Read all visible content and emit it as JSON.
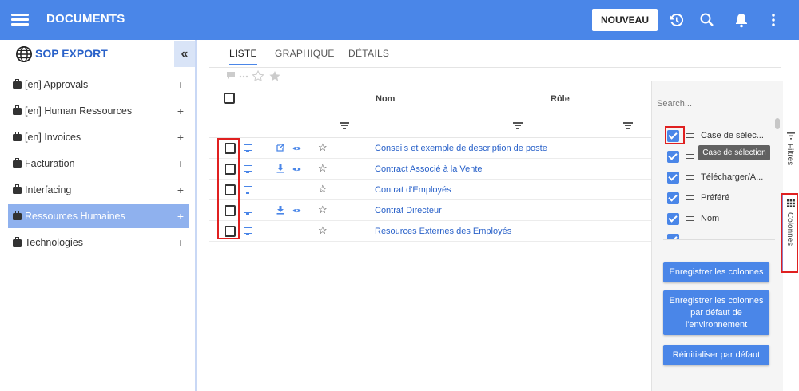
{
  "topbar": {
    "title": "DOCUMENTS",
    "new_button": "NOUVEAU",
    "icons": [
      "menu-icon",
      "history-icon",
      "search-icon",
      "bell-icon",
      "more-vert-icon"
    ],
    "color": "#4a86e8"
  },
  "sidebar": {
    "title": "SOP EXPORT",
    "collapse_glyph": "«",
    "items": [
      {
        "label": "[en] Approvals",
        "plus": "+"
      },
      {
        "label": "[en] Human Ressources",
        "plus": "+"
      },
      {
        "label": "[en] Invoices",
        "plus": "+"
      },
      {
        "label": "Facturation",
        "plus": "+"
      },
      {
        "label": "Interfacing",
        "plus": "+"
      },
      {
        "label": "Ressources Humaines",
        "plus": "+",
        "active": true
      },
      {
        "label": "Technologies",
        "plus": "+"
      }
    ]
  },
  "tabs": [
    {
      "label": "LISTE",
      "active": true
    },
    {
      "label": "GRAPHIQUE"
    },
    {
      "label": "DÉTAILS"
    }
  ],
  "grid": {
    "columns": {
      "name": "Nom",
      "role": "Rôle"
    },
    "rows": [
      {
        "name": "Conseils et exemple de description de poste",
        "action": "open-external"
      },
      {
        "name": "Contract Associé à la Vente",
        "action": "download"
      },
      {
        "name": "Contrat d'Employés",
        "action": "none"
      },
      {
        "name": "Contrat Directeur",
        "action": "download"
      },
      {
        "name": "Resources Externes des Employés",
        "action": "none"
      }
    ]
  },
  "column_panel": {
    "search_placeholder": "Search...",
    "columns": [
      {
        "label": "Case de sélec...",
        "checked": true
      },
      {
        "label": "",
        "checked": true
      },
      {
        "label": "Télécharger/A...",
        "checked": true
      },
      {
        "label": "Préféré",
        "checked": true
      },
      {
        "label": "Nom",
        "checked": true
      }
    ],
    "tooltip": "Case de sélection",
    "save_button": "Enregistrer les colonnes",
    "save_default_button": "Enregistrer les colonnes par défaut de l'environnement",
    "reset_button": "Réinitialiser par défaut"
  },
  "side_tabs": {
    "filters": "Filtres",
    "columns": "Colonnes"
  },
  "colors": {
    "accent": "#4a86e8",
    "highlight": "#e02020",
    "active_item": "#8fb1ee"
  }
}
